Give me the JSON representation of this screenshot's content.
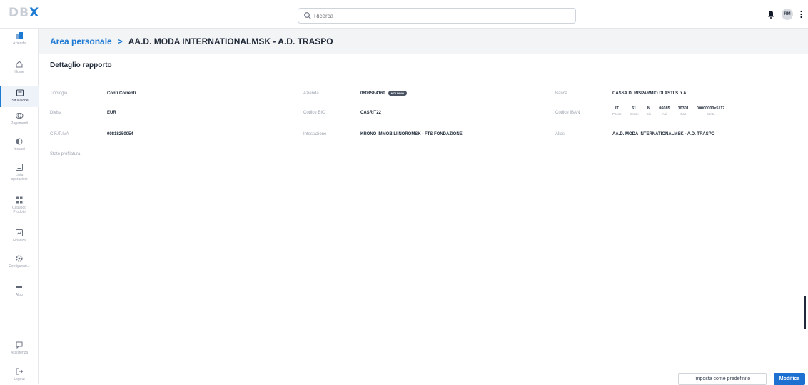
{
  "app": {
    "logo_left": "DB",
    "logo_right": "X"
  },
  "search": {
    "placeholder": "Ricerca"
  },
  "user": {
    "initials": "RM"
  },
  "sidebar": {
    "items": [
      {
        "label": "Aziende",
        "icon": "building-icon"
      },
      {
        "label": "Home",
        "icon": "home-icon"
      },
      {
        "label": "Situazione",
        "icon": "wallet-icon"
      },
      {
        "label": "Pagamenti",
        "icon": "payments-icon"
      },
      {
        "label": "Incassi",
        "icon": "incassi-icon"
      },
      {
        "label": "Lista operazioni",
        "icon": "list-icon"
      },
      {
        "label": "Catalogo Prodotti",
        "icon": "grid-icon"
      },
      {
        "label": "Finanza",
        "icon": "finance-icon"
      },
      {
        "label": "Configurazi...",
        "icon": "settings-icon"
      },
      {
        "label": "Altro",
        "icon": "more-icon"
      },
      {
        "label": "Assistenza",
        "icon": "chat-icon"
      },
      {
        "label": "Logout",
        "icon": "logout-icon"
      }
    ]
  },
  "breadcrumb": {
    "area": "Area personale",
    "separator": ">",
    "current": "AA.D. MODA INTERNATIONALMSK - A.D. TRASPO"
  },
  "section_title": "Dettaglio rapporto",
  "details": {
    "tipologia": {
      "label": "Tipologia",
      "value": "Conti Correnti"
    },
    "divisa": {
      "label": "Divisa",
      "value": "EUR"
    },
    "cf": {
      "label": "C.F./P.IVA",
      "value": "00818250054"
    },
    "stato": {
      "label": "Stato profilatura"
    },
    "azienda": {
      "label": "Azienda",
      "value": "0608SE4160",
      "badge": "HOLDING"
    },
    "bic": {
      "label": "Codice BIC",
      "value": "CASRIT22"
    },
    "intestazione": {
      "label": "Intestazione",
      "value": "KRONO IMMOBILI NOROMSK - FTS FONDAZIONE"
    },
    "banca": {
      "label": "Banca",
      "value": "CASSA DI RISPARMIO DI ASTI S.p.A."
    },
    "iban_label": "Codice IBAN",
    "iban": [
      {
        "value": "IT",
        "label": "Paese"
      },
      {
        "value": "61",
        "label": "Check"
      },
      {
        "value": "N",
        "label": "Cin"
      },
      {
        "value": "06085",
        "label": "Abi"
      },
      {
        "value": "10301",
        "label": "Cab"
      },
      {
        "value": "00000000x5117",
        "label": "Conto"
      }
    ],
    "alias": {
      "label": "Alias",
      "value": "AA.D. MODA INTERNATIONALMSK - A.D. TRASPO"
    }
  },
  "footer": {
    "default_button": "Imposta come predefinito",
    "edit_button": "Modifica"
  },
  "colors": {
    "accent": "#1d7ad3",
    "primary_button": "#1d6fd0"
  }
}
